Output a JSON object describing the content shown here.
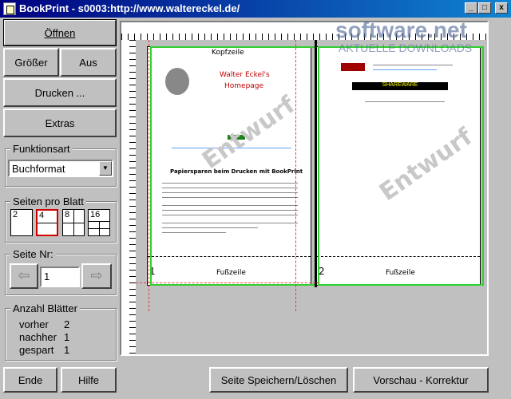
{
  "window": {
    "title": "BookPrint - s0003:http://www.waltereckel.de/",
    "minimize": "_",
    "maximize": "□",
    "close": "x"
  },
  "watermark_logo": {
    "brand": "software.net",
    "tagline": "AKTUELLE DOWNLOADS"
  },
  "buttons": {
    "open": "Öffnen",
    "bigger": "Größer",
    "off": "Aus",
    "print": "Drucken ...",
    "extras": "Extras",
    "end": "Ende",
    "help": "Hilfe",
    "save_delete": "Seite Speichern/Löschen",
    "preview_correct": "Vorschau - Korrektur"
  },
  "function_type": {
    "label": "Funktionsart",
    "value": "Buchformat"
  },
  "pages_per_sheet": {
    "label": "Seiten pro Blatt",
    "options": [
      "2",
      "4",
      "8",
      "16"
    ],
    "selected": "4"
  },
  "page_number": {
    "label": "Seite Nr:",
    "value": "1"
  },
  "sheet_count": {
    "label": "Anzahl Blätter",
    "rows": [
      {
        "name": "vorher",
        "value": "2"
      },
      {
        "name": "nachher",
        "value": "1"
      },
      {
        "name": "gespart",
        "value": "1"
      }
    ]
  },
  "preview": {
    "header": "Kopfzeile",
    "footer": "Fußzeile",
    "watermark": "Entwurf",
    "page1_number": "1",
    "page2_number": "2",
    "page1_title": "Walter Eckel's",
    "page1_subtitle": "Homepage",
    "page1_heading": "Papiersparen beim Drucken mit BookPrint",
    "page2_banner": "SHAREWARE"
  },
  "colors": {
    "title_start": "#000080",
    "title_end": "#1084d0",
    "selection_red": "#d00000",
    "green_frame": "#30d030",
    "guide_red": "#e04040"
  }
}
